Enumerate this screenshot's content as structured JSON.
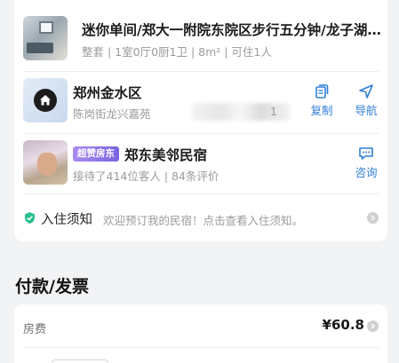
{
  "listing": {
    "title": "迷你单间/郑大一附院东院区步行五分钟/龙子湖…",
    "details": "整套 | 1室0厅0厨1卫 | 8m² | 可住1人"
  },
  "location": {
    "title": "郑州金水区",
    "address": "陈岗街龙兴嘉苑",
    "address_suffix": "1",
    "actions": {
      "copy_label": "复制",
      "navigate_label": "导航"
    }
  },
  "host": {
    "badge": "超赞房东",
    "name": "郑东美邻民宿",
    "stats": "接待了414位客人 | 84条评价",
    "consult_label": "咨询"
  },
  "notice": {
    "title": "入住须知",
    "text": "欢迎预订我的民宿！点击查看入住须知。"
  },
  "payment": {
    "section_title": "付款/发票",
    "fee_label": "房费",
    "fee_value": "¥60.8"
  },
  "colors": {
    "accent": "#2f7ed8",
    "badge": "#7a63e0",
    "notice_icon": "#2bbf8a"
  }
}
